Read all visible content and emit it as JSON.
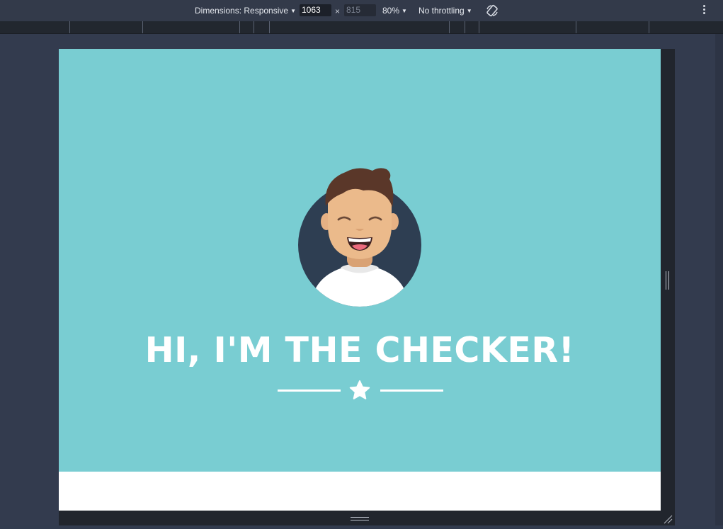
{
  "toolbar": {
    "dimensions_label": "Dimensions: Responsive",
    "width_value": "1063",
    "times_sign": "×",
    "height_placeholder": "815",
    "zoom_label": "80%",
    "throttling_label": "No throttling",
    "rotate_icon": "rotate-icon",
    "more_icon": "more-options-icon"
  },
  "page": {
    "heading": "HI, I'M THE CHECKER!",
    "avatar_icon": "smiling-man-avatar",
    "divider_icon": "star-icon"
  },
  "colors": {
    "hero_background": "#79cdd2",
    "avatar_circle": "#2e3e52",
    "devtools_background": "#333a4a",
    "text_on_hero": "#ffffff"
  }
}
